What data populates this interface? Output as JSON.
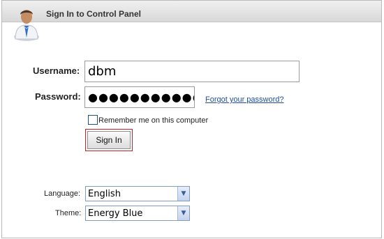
{
  "header": {
    "title": "Sign In to Control Panel",
    "icon": "user-avatar-icon"
  },
  "form": {
    "username_label": "Username:",
    "username_value": "dbm",
    "password_label": "Password:",
    "password_mask": "●●●●●●●●●●●●●",
    "forgot_link": "Forgot your password?",
    "remember_label": "Remember me on this computer",
    "remember_checked": false,
    "sign_in_label": "Sign In"
  },
  "settings": {
    "language_label": "Language:",
    "language_value": "English",
    "theme_label": "Theme:",
    "theme_value": "Energy Blue"
  },
  "colors": {
    "link": "#1f4ea1",
    "button_focus_border": "#c0202a",
    "select_border": "#7f9db9"
  }
}
